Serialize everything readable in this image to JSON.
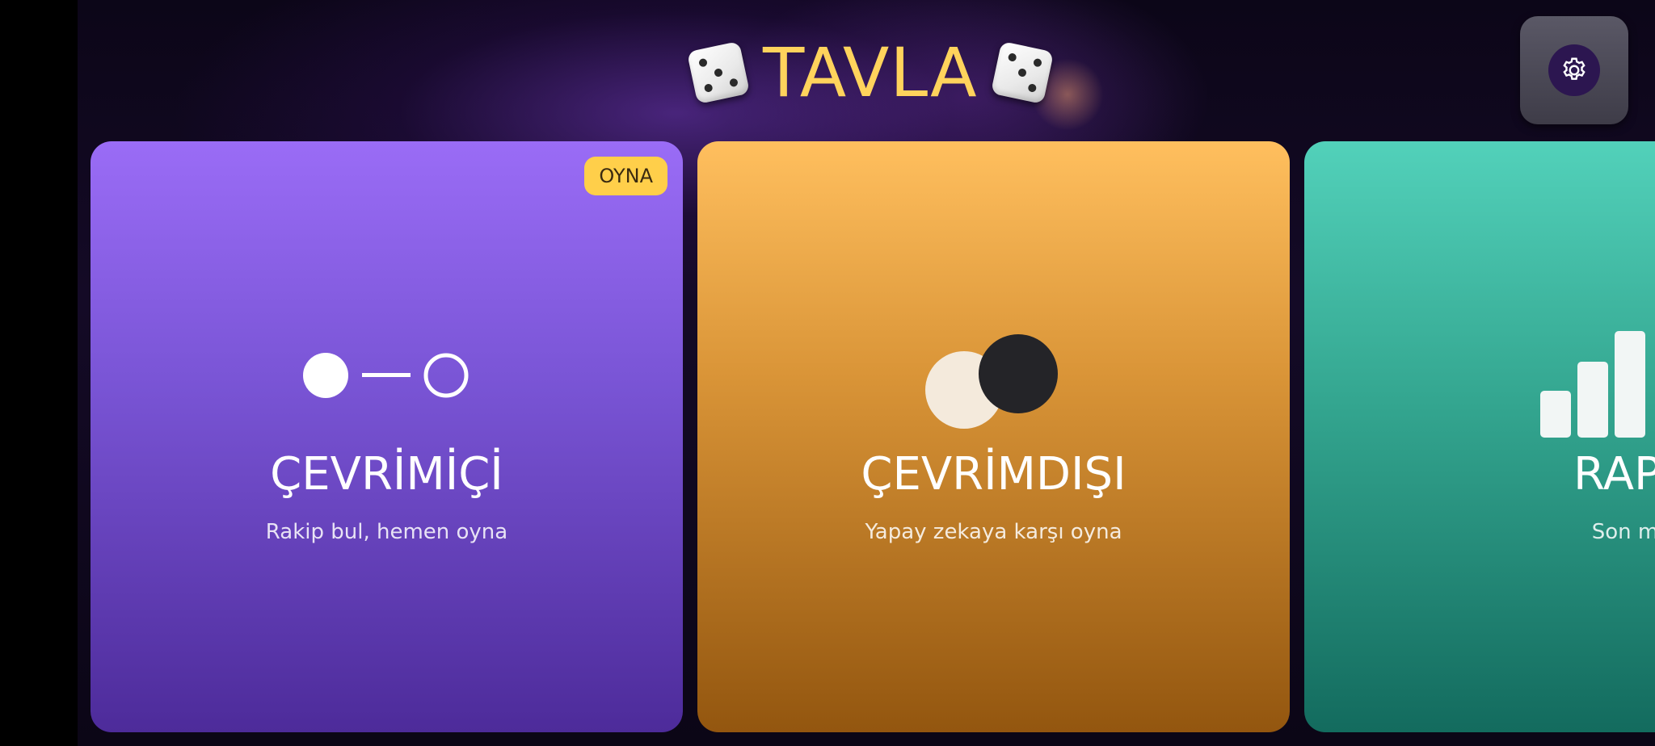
{
  "header": {
    "title": "TAVLA",
    "left_icon": "dice-icon",
    "right_icon": "dice-icon",
    "title_color": "#ffd35c"
  },
  "settings": {
    "icon": "gear-icon"
  },
  "cards": [
    {
      "id": "online",
      "title": "ÇEVRİMİÇİ",
      "subtitle": "Rakip bul, hemen oyna",
      "badge": "OYNA",
      "icon": "connection-icon",
      "color_top": "#9a6cf6",
      "color_bottom": "#4d2b9a"
    },
    {
      "id": "offline",
      "title": "ÇEVRİMDIŞI",
      "subtitle": "Yapay zekaya karşı oyna",
      "icon": "checkers-pieces-icon",
      "color_top": "#ffbf5e",
      "color_bottom": "#93560f"
    },
    {
      "id": "reports",
      "title": "RAPORL",
      "subtitle": "Son maçlarını",
      "icon": "bar-chart-icon",
      "color_top": "#52d1ba",
      "color_bottom": "#136b5e"
    }
  ]
}
